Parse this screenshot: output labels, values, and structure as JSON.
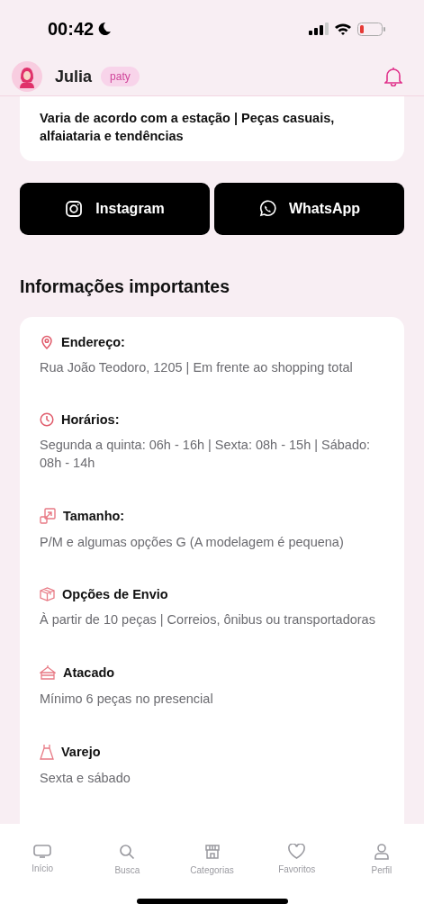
{
  "status_bar": {
    "time": "00:42"
  },
  "header": {
    "name": "Julia",
    "badge": "paty"
  },
  "style_card": {
    "text": "Varia de acordo com a estação | Peças casuais, alfaiataria e tendências"
  },
  "social_buttons": [
    {
      "kind": "instagram",
      "label": "Instagram"
    },
    {
      "kind": "whatsapp",
      "label": "WhatsApp"
    }
  ],
  "section_title": "Informações importantes",
  "info_items": [
    {
      "kind": "address",
      "title": "Endereço:",
      "text": "Rua João Teodoro, 1205 | Em frente ao shopping total"
    },
    {
      "kind": "hours",
      "title": "Horários:",
      "text": "Segunda a quinta: 06h - 16h | Sexta: 08h - 15h | Sábado: 08h - 14h"
    },
    {
      "kind": "size",
      "title": "Tamanho:",
      "text": "P/M e algumas opções G (A modelagem é pequena)"
    },
    {
      "kind": "shipping",
      "title": "Opções de Envio",
      "text": "À partir de 10 peças | Correios, ônibus ou transportadoras"
    },
    {
      "kind": "wholesale",
      "title": "Atacado",
      "text": "Mínimo 6 peças no presencial"
    },
    {
      "kind": "retail",
      "title": "Varejo",
      "text": "Sexta e sábado"
    }
  ],
  "tab_bar": [
    {
      "kind": "home",
      "label": "Início",
      "selected": false
    },
    {
      "kind": "search",
      "label": "Busca",
      "selected": false
    },
    {
      "kind": "store",
      "label": "Categorias",
      "selected": false
    },
    {
      "kind": "heart",
      "label": "Favoritos",
      "selected": false
    },
    {
      "kind": "profile",
      "label": "Perfil",
      "selected": false
    }
  ]
}
